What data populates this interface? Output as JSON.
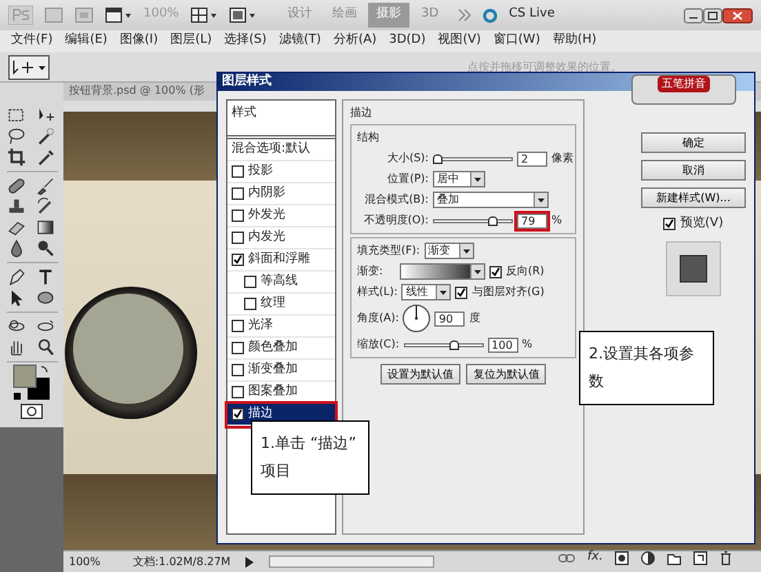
{
  "app_bar": {
    "zoom_field": "100%",
    "workspaces": [
      {
        "label": "设计",
        "selected": false
      },
      {
        "label": "绘画",
        "selected": false
      },
      {
        "label": "摄影",
        "selected": true
      },
      {
        "label": "3D",
        "selected": false
      }
    ],
    "cs_live": "CS Live"
  },
  "menu": [
    "文件(F)",
    "编辑(E)",
    "图像(I)",
    "图层(L)",
    "选择(S)",
    "滤镜(T)",
    "分析(A)",
    "3D(D)",
    "视图(V)",
    "窗口(W)",
    "帮助(H)"
  ],
  "options_bar": {
    "hint": "点按并拖移可调整效果的位置。"
  },
  "document": {
    "tab": "按钮背景.psd @ 100% (形"
  },
  "status_bar": {
    "zoom": "100%",
    "doc_size": "文档:1.02M/8.27M"
  },
  "layers_panel": {
    "fx": "fx."
  },
  "dialog": {
    "title": "图层样式",
    "styles_header": "样式",
    "styles": [
      {
        "label": "混合选项:默认",
        "kind": "plain",
        "selected": false
      },
      {
        "label": "投影",
        "kind": "checkbox",
        "checked": false,
        "selected": false
      },
      {
        "label": "内阴影",
        "kind": "checkbox",
        "checked": false,
        "selected": false
      },
      {
        "label": "外发光",
        "kind": "checkbox",
        "checked": false,
        "selected": false
      },
      {
        "label": "内发光",
        "kind": "checkbox",
        "checked": false,
        "selected": false
      },
      {
        "label": "斜面和浮雕",
        "kind": "checkbox",
        "checked": true,
        "selected": false,
        "children": [
          {
            "label": "等高线",
            "kind": "checkbox",
            "checked": false,
            "selected": false
          },
          {
            "label": "纹理",
            "kind": "checkbox",
            "checked": false,
            "selected": false
          }
        ]
      },
      {
        "label": "光泽",
        "kind": "checkbox",
        "checked": false,
        "selected": false
      },
      {
        "label": "颜色叠加",
        "kind": "checkbox",
        "checked": false,
        "selected": false
      },
      {
        "label": "渐变叠加",
        "kind": "checkbox",
        "checked": false,
        "selected": false
      },
      {
        "label": "图案叠加",
        "kind": "checkbox",
        "checked": false,
        "selected": false
      },
      {
        "label": "描边",
        "kind": "checkbox",
        "checked": true,
        "selected": true
      }
    ],
    "section_title": "描边",
    "structure": {
      "title": "结构",
      "size": {
        "label": "大小(S):",
        "level": 0.0,
        "value": "2",
        "unit": "像素"
      },
      "position": {
        "label": "位置(P):",
        "value": "居中"
      },
      "blend_mode": {
        "label": "混合模式(B):",
        "value": "叠加"
      },
      "opacity": {
        "label": "不透明度(O):",
        "level": 0.79,
        "value": "79",
        "unit": "%",
        "highlighted": true
      }
    },
    "fill": {
      "label": "填充类型(F):",
      "value": "渐变",
      "gradient_label": "渐变:",
      "reverse": {
        "label": "反向(R)",
        "checked": true
      },
      "style": {
        "label": "样式(L):",
        "value": "线性"
      },
      "align": {
        "label": "与图层对齐(G)",
        "checked": true
      },
      "angle": {
        "label": "角度(A):",
        "value": "90",
        "unit": "度"
      },
      "scale": {
        "label": "缩放(C):",
        "level": 0.65,
        "value": "100",
        "unit": "%"
      }
    },
    "default_buttons": [
      "设置为默认值",
      "复位为默认值"
    ],
    "buttons": [
      "确定",
      "取消",
      "新建样式(W)..."
    ],
    "preview": {
      "label": "预览(V)",
      "checked": true
    }
  },
  "ime_bar": {
    "label": "五笔拼音"
  },
  "callouts": [
    {
      "text": "1.单击 “描边” 项目"
    },
    {
      "text": "2.设置其各项参数"
    }
  ]
}
